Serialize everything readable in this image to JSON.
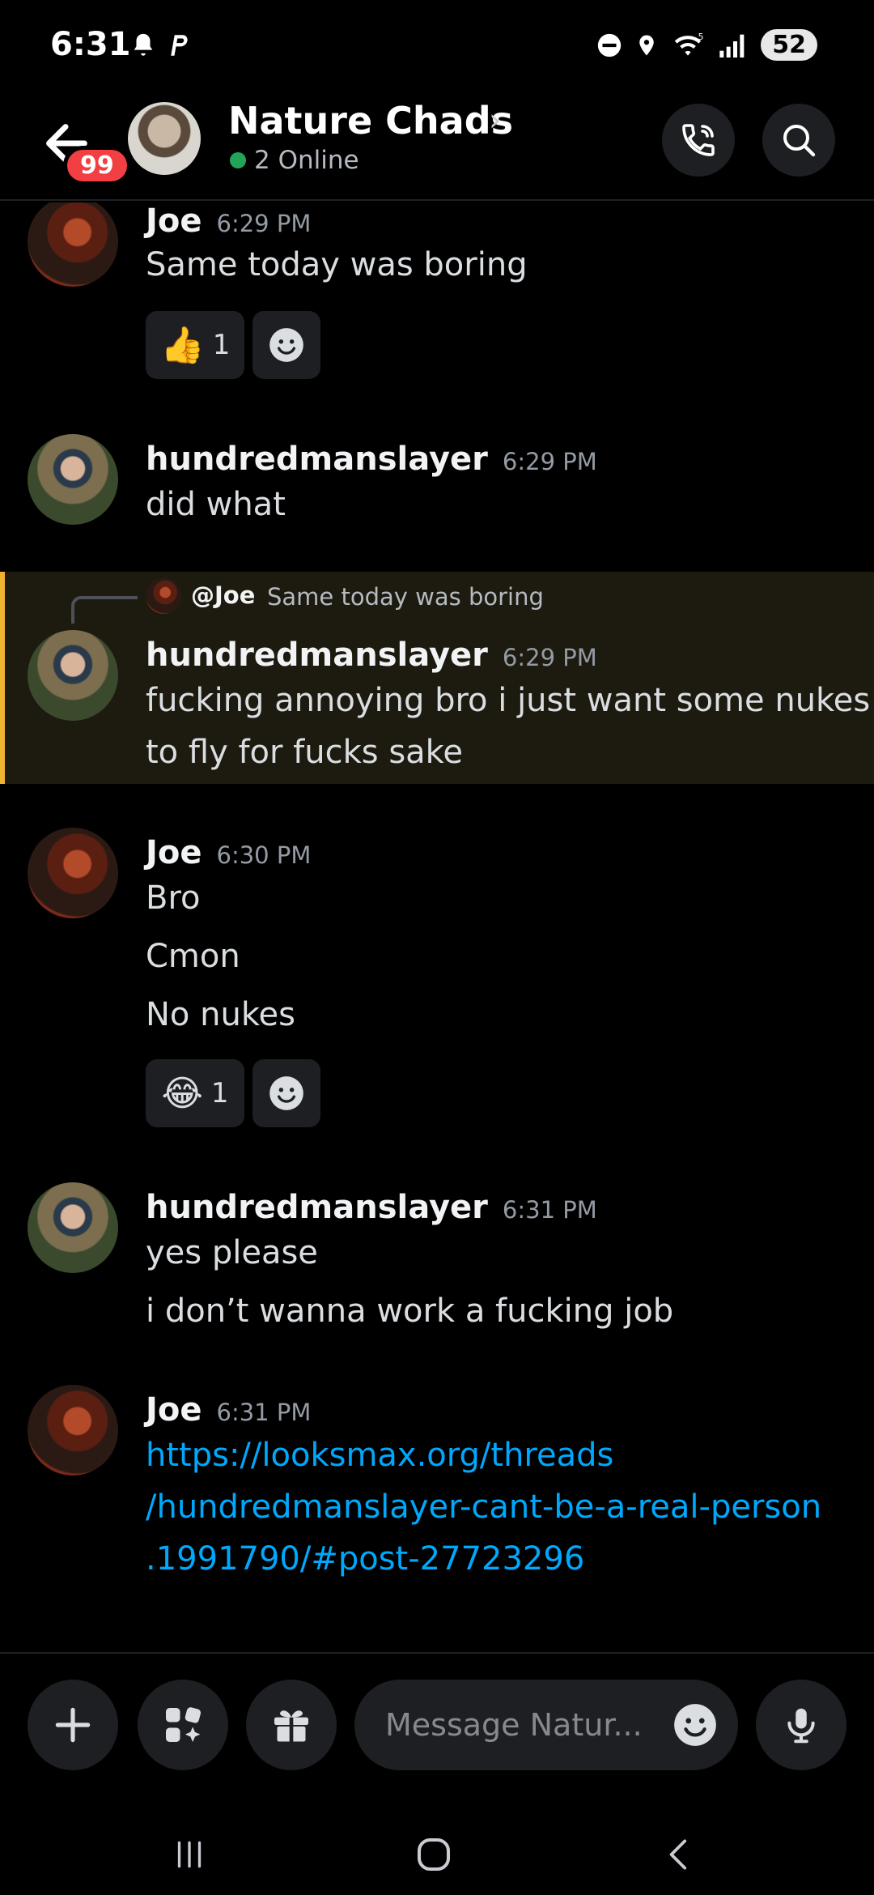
{
  "status_bar": {
    "time": "6:31",
    "battery": "52"
  },
  "header": {
    "unread_badge": "99",
    "title": "Nature Chads",
    "online": "2 Online"
  },
  "messages": [
    {
      "author": "Joe",
      "time": "6:29 PM",
      "lines": [
        "Same today was boring"
      ],
      "reaction": {
        "emoji": "👍",
        "count": "1"
      }
    },
    {
      "author": "hundredmanslayer",
      "time": "6:29 PM",
      "lines": [
        "did what"
      ]
    },
    {
      "reply_to": {
        "author": "@Joe",
        "text": "Same today was boring"
      },
      "author": "hundredmanslayer",
      "time": "6:29 PM",
      "lines": [
        "fucking annoying bro i just want some nukes",
        "to fly for fucks sake"
      ]
    },
    {
      "author": "Joe",
      "time": "6:30 PM",
      "lines": [
        "Bro",
        "Cmon",
        "No nukes"
      ],
      "reaction": {
        "emoji": "😂",
        "count": "1"
      }
    },
    {
      "author": "hundredmanslayer",
      "time": "6:31 PM",
      "lines": [
        "yes please",
        "i don’t wanna work a fucking job"
      ]
    },
    {
      "author": "Joe",
      "time": "6:31 PM",
      "lines": [
        "https://looksmax.org/threads",
        "/hundredmanslayer-cant-be-a-real-person",
        ".1991790/#post-27723296"
      ]
    }
  ],
  "composer": {
    "placeholder": "Message Natur..."
  },
  "colors": {
    "accent_link": "#00a8fc",
    "online": "#23a559",
    "badge": "#f23f43",
    "highlight_bar": "#f0b232"
  }
}
